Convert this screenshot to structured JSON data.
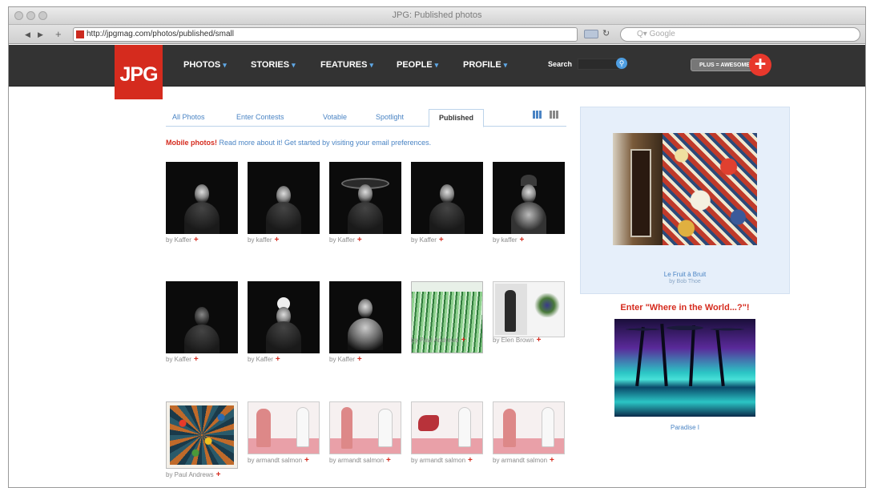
{
  "browser": {
    "window_title": "JPG: Published photos",
    "url": "http://jpgmag.com/photos/published/small",
    "search_placeholder": "Q▾ Google",
    "back_label": "◀",
    "forward_label": "▶",
    "plus_label": "+"
  },
  "site": {
    "logo": "JPG",
    "nav": [
      {
        "label": "PHOTOS",
        "arrow": "▾"
      },
      {
        "label": "STORIES",
        "arrow": "▾"
      },
      {
        "label": "FEATURES",
        "arrow": "▾"
      },
      {
        "label": "PEOPLE",
        "arrow": "▾"
      },
      {
        "label": "PROFILE",
        "arrow": "▾"
      }
    ],
    "search_label": "Search",
    "plus_badge": "PLUS = AWESOME",
    "plus_icon": "+"
  },
  "tabs": [
    "All Photos",
    "Enter Contests",
    "Votable",
    "Spotlight",
    "Published"
  ],
  "active_tab": "Published",
  "notice": {
    "alert": "Mobile photos!",
    "text": " Read more about it! Get started by visiting your ",
    "link": "email preferences."
  },
  "photos": [
    {
      "caption": "by Kaffer"
    },
    {
      "caption": "by kaffer"
    },
    {
      "caption": "by Kaffer"
    },
    {
      "caption": "by Kaffer"
    },
    {
      "caption": "by kaffer"
    },
    {
      "caption": "by Kaffer"
    },
    {
      "caption": "by Kaffer"
    },
    {
      "caption": "by Kaffer"
    },
    {
      "caption": "by Paul Andrews"
    },
    {
      "caption": "by Elen Brown"
    },
    {
      "caption": "by Paul Andrews"
    },
    {
      "caption": "by armandt salmon"
    },
    {
      "caption": "by armandt salmon"
    },
    {
      "caption": "by armandt salmon"
    },
    {
      "caption": "by armandt salmon"
    }
  ],
  "sidebar": {
    "feature_title": "Le Fruit à Bruit",
    "feature_byline": "by Bob Thoe",
    "contest_heading": "Enter \"Where in the World...?\"!",
    "contest_caption": "Paradise I"
  },
  "colors": {
    "brand_red": "#d52b1e",
    "nav_bg": "#333333",
    "link_blue": "#4a84c4",
    "sidebar_bg": "#e6effa"
  }
}
